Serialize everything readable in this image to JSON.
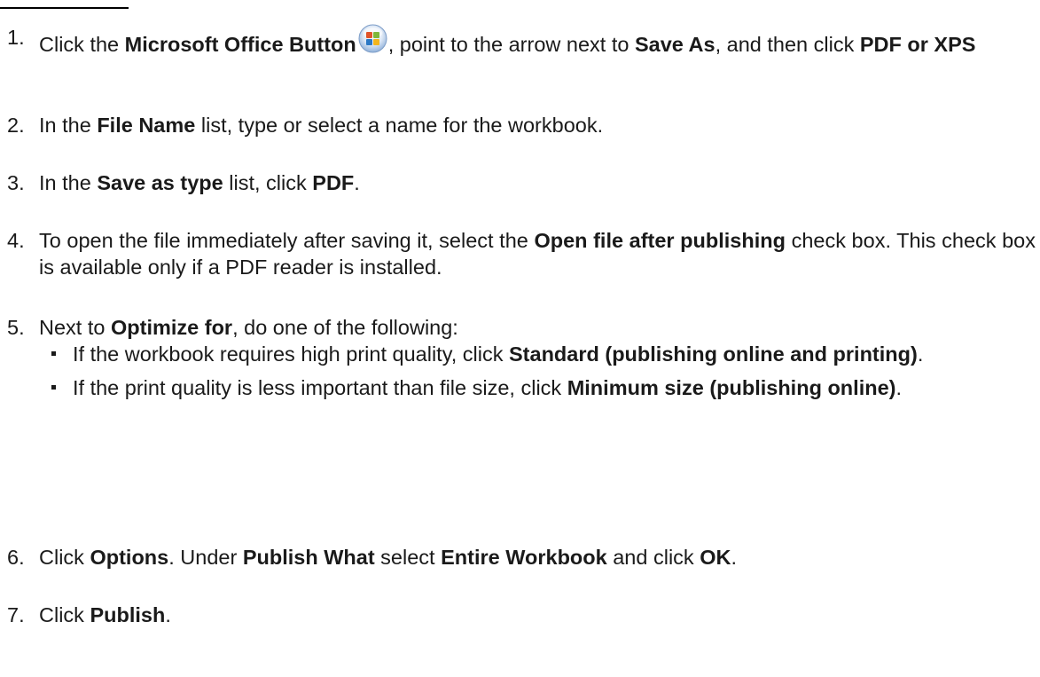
{
  "steps": [
    {
      "number": "1.",
      "t1": "Click the ",
      "b1": "Microsoft Office Button",
      "t2": ", point to the arrow next to ",
      "b2": "Save As",
      "t3": ", and then click ",
      "b3": "PDF or XPS",
      "icon": "office-button-icon"
    },
    {
      "number": "2.",
      "t1": "In the ",
      "b1": "File Name",
      "t2": " list, type or select a name for the workbook."
    },
    {
      "number": "3.",
      "t1": "In the ",
      "b1": "Save as type",
      "t2": " list, click ",
      "b2": "PDF",
      "t3": "."
    },
    {
      "number": "4.",
      "t1": "To open the file immediately after saving it, select the ",
      "b1": "Open file after publishing",
      "t2": " check box. This check box is available only if a PDF reader is installed."
    },
    {
      "number": "5.",
      "t1": "Next to ",
      "b1": "Optimize for",
      "t2": ", do one of the following:",
      "subitems": [
        {
          "t1": "If the workbook requires high print quality, click ",
          "b1": "Standard (publishing online and printing)",
          "t2": "."
        },
        {
          "t1": "If the print quality is less important than file size, click ",
          "b1": "Minimum size (publishing online)",
          "t2": "."
        }
      ]
    },
    {
      "number": "6.",
      "t1": "Click ",
      "b1": "Options",
      "t2": ". Under ",
      "b2": "Publish What",
      "t3": " select ",
      "b3": "Entire Workbook",
      "t4": " and click ",
      "b4": "OK",
      "t5": "."
    },
    {
      "number": "7.",
      "t1": "Click ",
      "b1": "Publish",
      "t2": "."
    }
  ]
}
